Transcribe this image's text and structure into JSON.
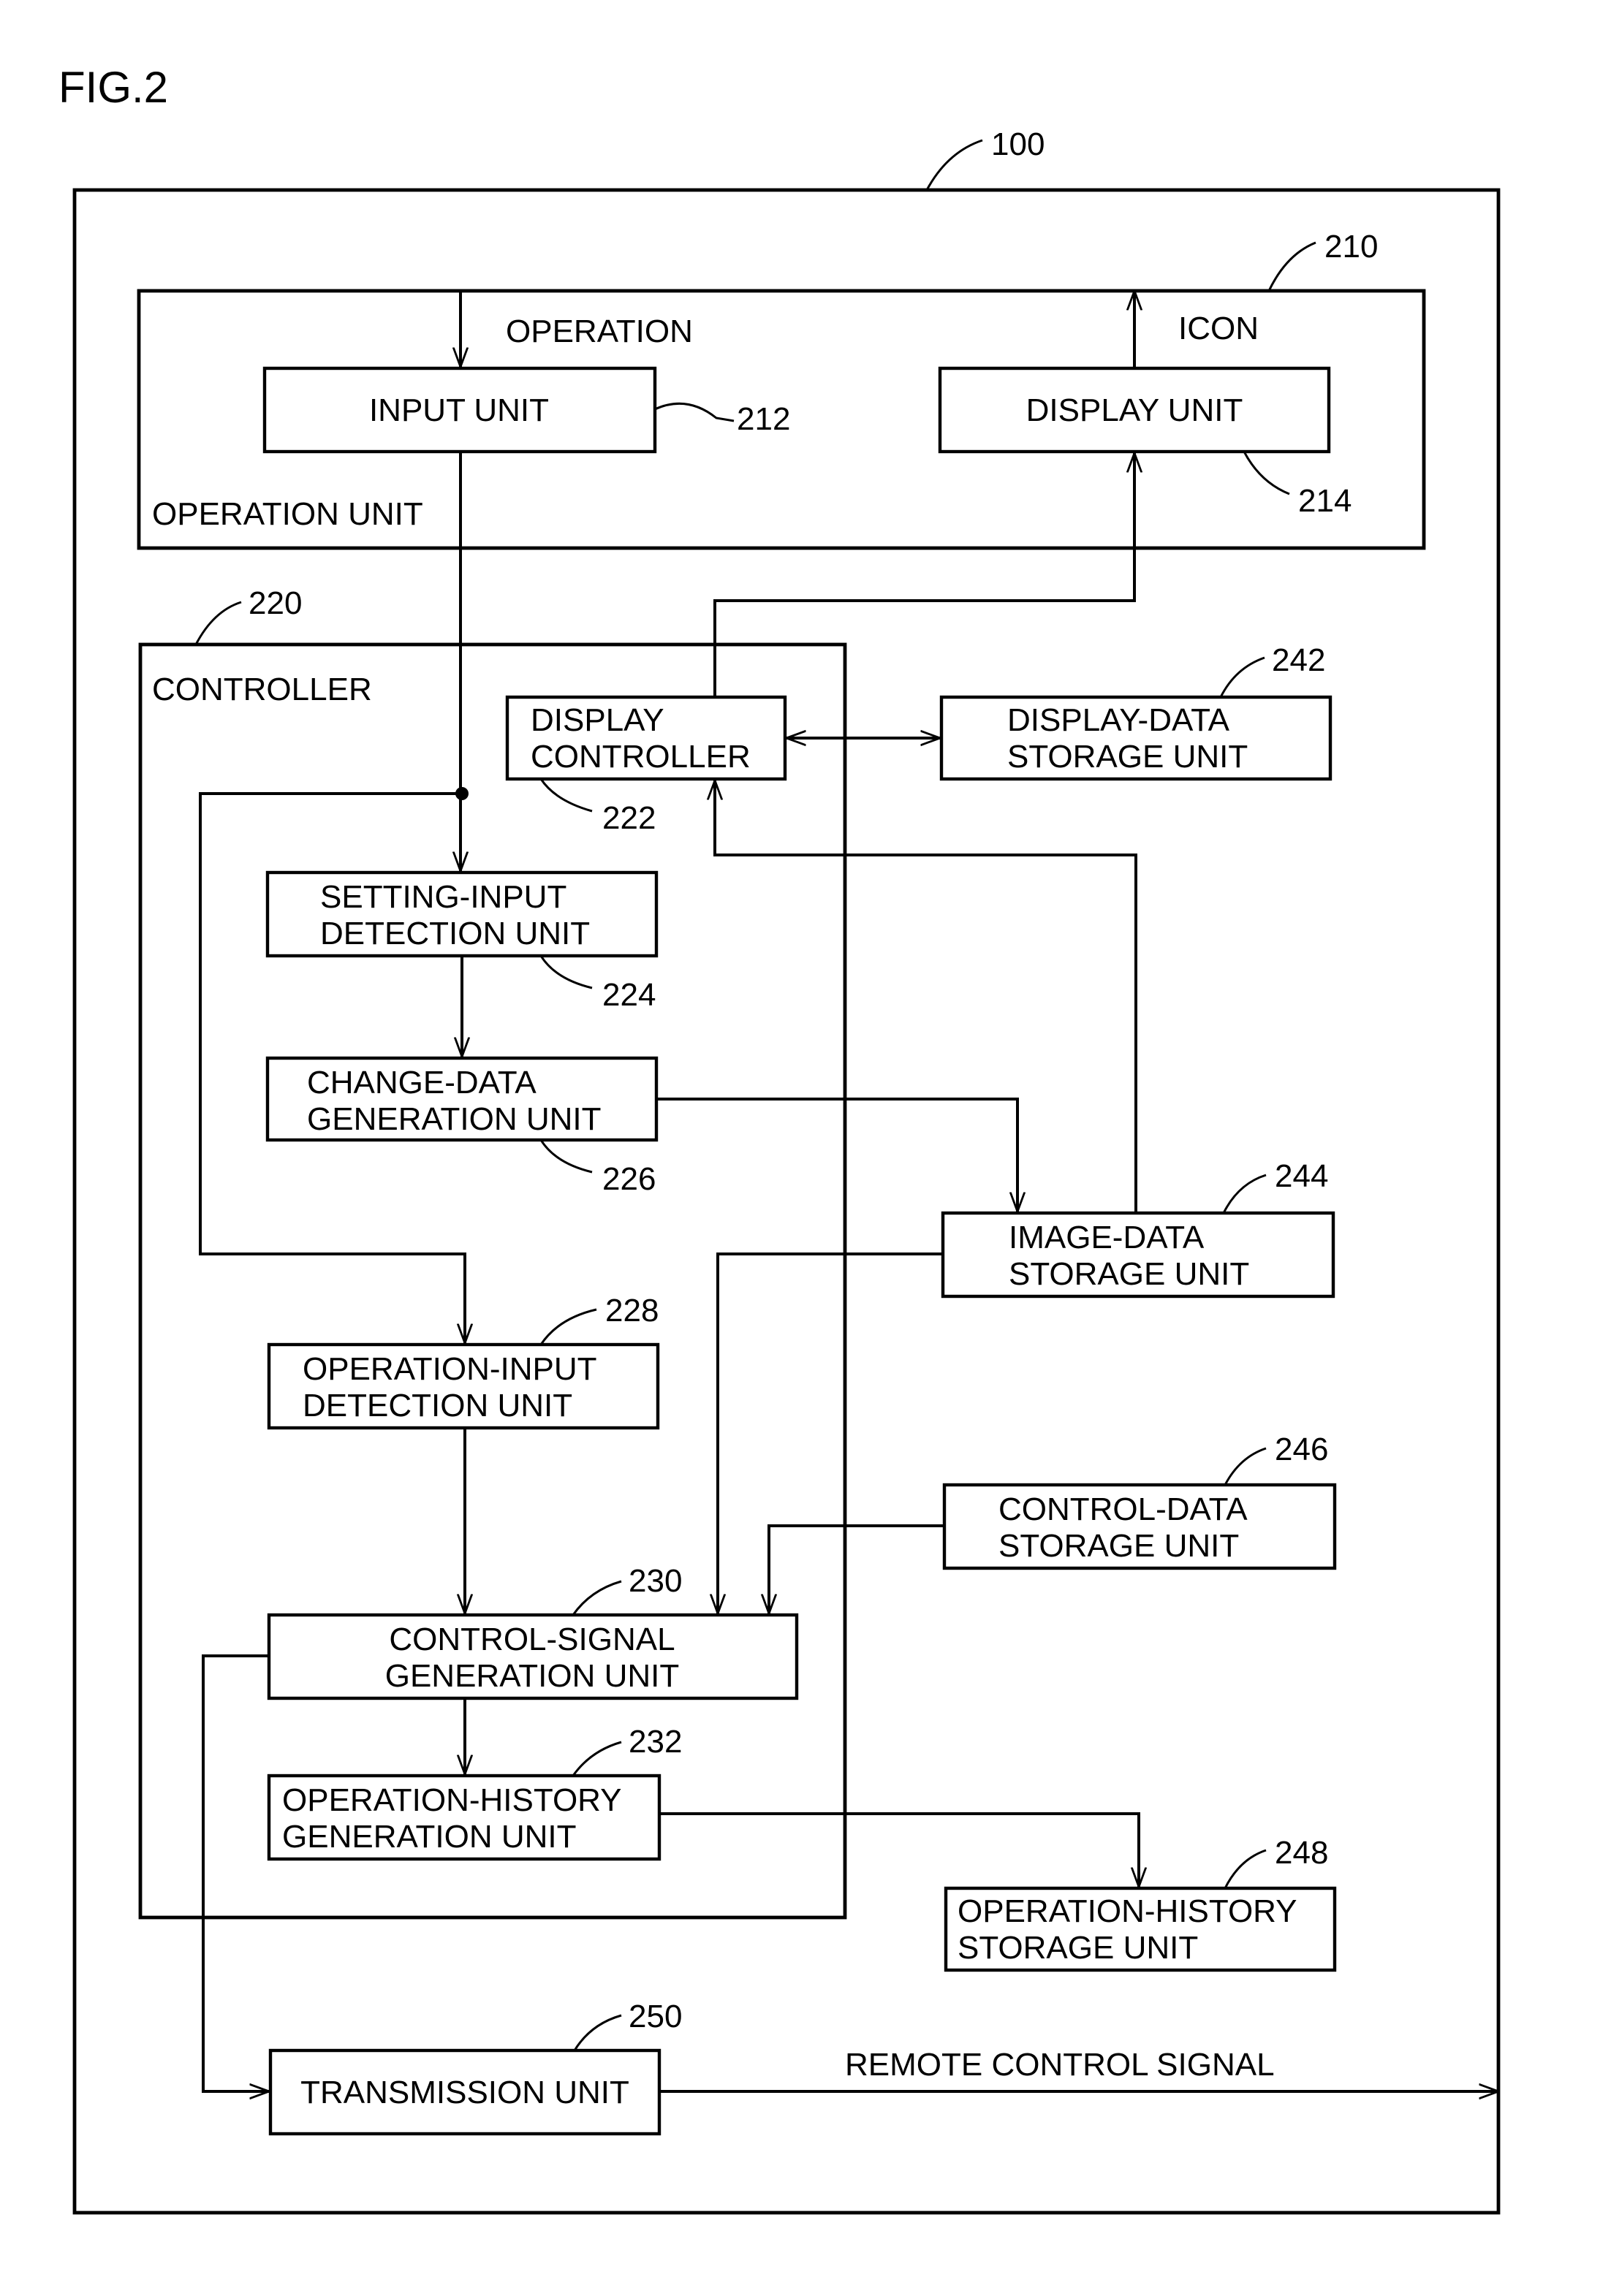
{
  "figure_label": "FIG.2",
  "device": {
    "ref": "100"
  },
  "operation_unit": {
    "ref": "210",
    "label": "OPERATION UNIT",
    "operation_label": "OPERATION",
    "icon_label": "ICON",
    "input_unit": {
      "ref": "212",
      "label": "INPUT UNIT"
    },
    "display_unit": {
      "ref": "214",
      "label": "DISPLAY UNIT"
    }
  },
  "controller": {
    "ref": "220",
    "label": "CONTROLLER",
    "display_controller": {
      "ref": "222",
      "lines": [
        "DISPLAY",
        "CONTROLLER"
      ]
    },
    "setting_input_detection": {
      "ref": "224",
      "lines": [
        "SETTING-INPUT",
        "DETECTION UNIT"
      ]
    },
    "change_data_generation": {
      "ref": "226",
      "lines": [
        "CHANGE-DATA",
        "GENERATION UNIT"
      ]
    },
    "operation_input_detection": {
      "ref": "228",
      "lines": [
        "OPERATION-INPUT",
        "DETECTION UNIT"
      ]
    },
    "control_signal_generation": {
      "ref": "230",
      "lines": [
        "CONTROL-SIGNAL",
        "GENERATION UNIT"
      ]
    },
    "operation_history_generation": {
      "ref": "232",
      "lines": [
        "OPERATION-HISTORY",
        "GENERATION UNIT"
      ]
    }
  },
  "storage": {
    "display_data": {
      "ref": "242",
      "lines": [
        "DISPLAY-DATA",
        "STORAGE UNIT"
      ]
    },
    "image_data": {
      "ref": "244",
      "lines": [
        "IMAGE-DATA",
        "STORAGE UNIT"
      ]
    },
    "control_data": {
      "ref": "246",
      "lines": [
        "CONTROL-DATA",
        "STORAGE UNIT"
      ]
    },
    "operation_history": {
      "ref": "248",
      "lines": [
        "OPERATION-HISTORY",
        "STORAGE UNIT"
      ]
    }
  },
  "transmission_unit": {
    "ref": "250",
    "label": "TRANSMISSION UNIT"
  },
  "remote_signal_label": "REMOTE CONTROL SIGNAL"
}
